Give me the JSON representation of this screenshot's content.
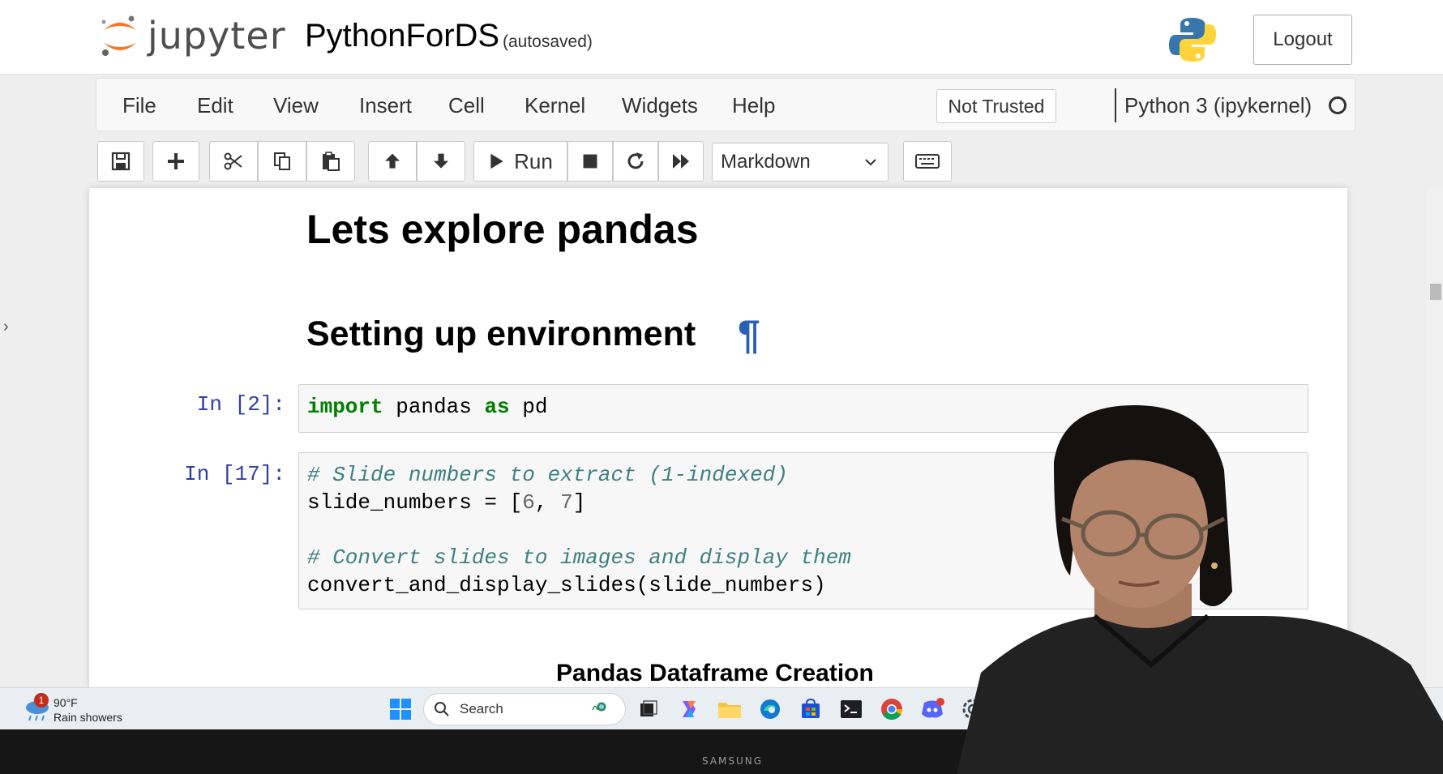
{
  "header": {
    "logo_text": "jupyter",
    "notebook_title": "PythonForDS",
    "autosave_status": "(autosaved)",
    "logout_label": "Logout",
    "python_logo": "python-logo"
  },
  "menubar": {
    "items": [
      "File",
      "Edit",
      "View",
      "Insert",
      "Cell",
      "Kernel",
      "Widgets",
      "Help"
    ],
    "trust_label": "Not Trusted",
    "kernel_name": "Python 3 (ipykernel)",
    "kernel_status": "idle-circle"
  },
  "toolbar": {
    "buttons": [
      "save-icon",
      "plus-icon",
      "scissors-icon",
      "copy-icon",
      "paste-icon",
      "arrow-up-icon",
      "arrow-down-icon",
      "run-icon",
      "stop-icon",
      "restart-icon",
      "fast-forward-icon",
      "keyboard-icon"
    ],
    "run_label": "Run",
    "cell_type": "Markdown"
  },
  "notebook": {
    "heading1": "Lets explore pandas",
    "heading2": "Setting up environment",
    "anchor_symbol": "¶",
    "cells": [
      {
        "prompt": "In [2]:",
        "lines": [
          [
            {
              "t": "import",
              "c": "kw"
            },
            {
              "t": " pandas ",
              "c": ""
            },
            {
              "t": "as",
              "c": "kw"
            },
            {
              "t": " pd",
              "c": ""
            }
          ]
        ]
      },
      {
        "prompt": "In [17]:",
        "lines": [
          [
            {
              "t": "# Slide numbers to extract (1-indexed)",
              "c": "cm"
            }
          ],
          [
            {
              "t": "slide_numbers = [",
              "c": ""
            },
            {
              "t": "6",
              "c": "num"
            },
            {
              "t": ", ",
              "c": ""
            },
            {
              "t": "7",
              "c": "num"
            },
            {
              "t": "]",
              "c": ""
            }
          ],
          [
            {
              "t": "",
              "c": ""
            }
          ],
          [
            {
              "t": "# Convert slides to images and display them",
              "c": "cm"
            }
          ],
          [
            {
              "t": "convert_and_display_slides(slide_numbers)",
              "c": ""
            }
          ]
        ]
      }
    ],
    "heading3_partial": "Pandas Dataframe Creation"
  },
  "taskbar": {
    "weather_temp": "90°F",
    "weather_desc": "Rain showers",
    "weather_badge": "1",
    "search_placeholder": "Search",
    "apps": [
      "windows-start-icon",
      "task-view-icon",
      "copilot-icon",
      "file-explorer-icon",
      "edge-icon",
      "store-icon",
      "terminal-icon",
      "chrome-icon",
      "discord-icon",
      "settings-icon"
    ]
  },
  "bezel": {
    "brand": "SAMSUNG"
  },
  "colors": {
    "jupyter_orange": "#f37726",
    "anchor_blue": "#2962b5",
    "prompt_blue": "#303f9f",
    "keyword_green": "#008000",
    "comment_teal": "#408080"
  }
}
